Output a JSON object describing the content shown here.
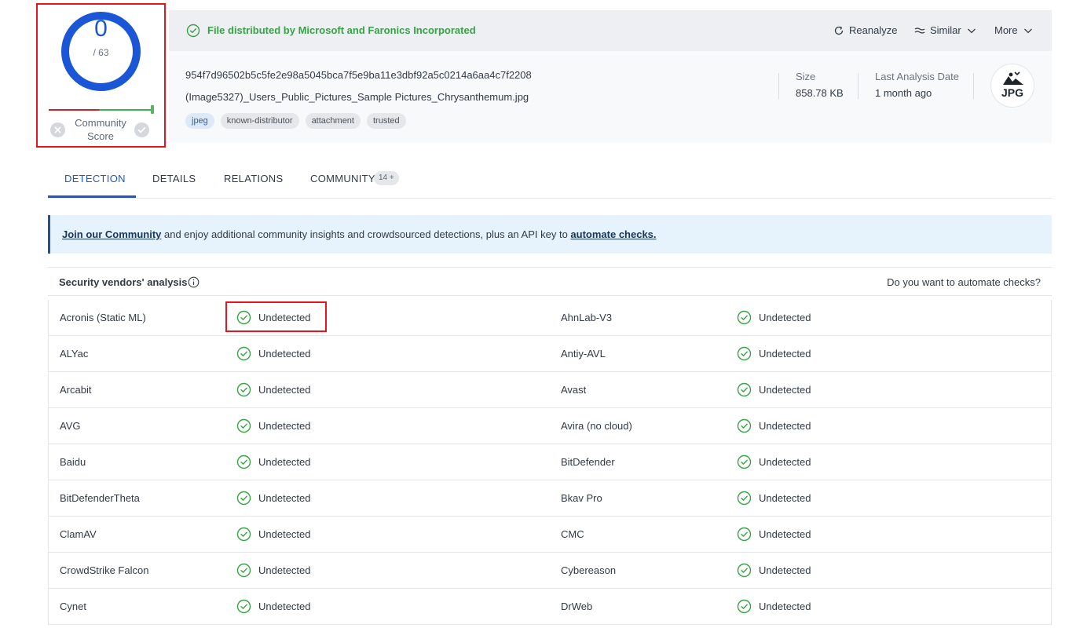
{
  "score": {
    "detections": "0",
    "total": "/ 63",
    "community_label": "Community Score"
  },
  "header": {
    "distribution": "File distributed by Microsoft and Faronics Incorporated",
    "actions": {
      "reanalyze": "Reanalyze",
      "similar": "Similar",
      "more": "More"
    },
    "hash": "954f7d96502b5c5fe2e98a5045bca7f5e9ba11e3dbf92a5c0214a6aa4c7f2208",
    "filename": "(Image5327)_Users_Public_Pictures_Sample Pictures_Chrysanthemum.jpg",
    "tags": [
      "jpeg",
      "known-distributor",
      "attachment",
      "trusted"
    ],
    "size_label": "Size",
    "size_value": "858.78 KB",
    "date_label": "Last Analysis Date",
    "date_value": "1 month ago",
    "file_type": "JPG"
  },
  "tabs": {
    "detection": "DETECTION",
    "details": "DETAILS",
    "relations": "RELATIONS",
    "community": "COMMUNITY",
    "community_badge": "14 +"
  },
  "banner": {
    "join_link": "Join our Community",
    "middle_text": " and enjoy additional community insights and crowdsourced detections, plus an API key to ",
    "automate_link": "automate checks."
  },
  "analysis": {
    "title": "Security vendors' analysis",
    "automate_question": "Do you want to automate checks?",
    "rows": [
      {
        "left_vendor": "Acronis (Static ML)",
        "left_result": "Undetected",
        "right_vendor": "AhnLab-V3",
        "right_result": "Undetected"
      },
      {
        "left_vendor": "ALYac",
        "left_result": "Undetected",
        "right_vendor": "Antiy-AVL",
        "right_result": "Undetected"
      },
      {
        "left_vendor": "Arcabit",
        "left_result": "Undetected",
        "right_vendor": "Avast",
        "right_result": "Undetected"
      },
      {
        "left_vendor": "AVG",
        "left_result": "Undetected",
        "right_vendor": "Avira (no cloud)",
        "right_result": "Undetected"
      },
      {
        "left_vendor": "Baidu",
        "left_result": "Undetected",
        "right_vendor": "BitDefender",
        "right_result": "Undetected"
      },
      {
        "left_vendor": "BitDefenderTheta",
        "left_result": "Undetected",
        "right_vendor": "Bkav Pro",
        "right_result": "Undetected"
      },
      {
        "left_vendor": "ClamAV",
        "left_result": "Undetected",
        "right_vendor": "CMC",
        "right_result": "Undetected"
      },
      {
        "left_vendor": "CrowdStrike Falcon",
        "left_result": "Undetected",
        "right_vendor": "Cybereason",
        "right_result": "Undetected"
      },
      {
        "left_vendor": "Cynet",
        "left_result": "Undetected",
        "right_vendor": "DrWeb",
        "right_result": "Undetected"
      }
    ]
  },
  "colors": {
    "accent": "#1b56d6",
    "clean": "#36a344",
    "highlight": "#e8141b"
  }
}
